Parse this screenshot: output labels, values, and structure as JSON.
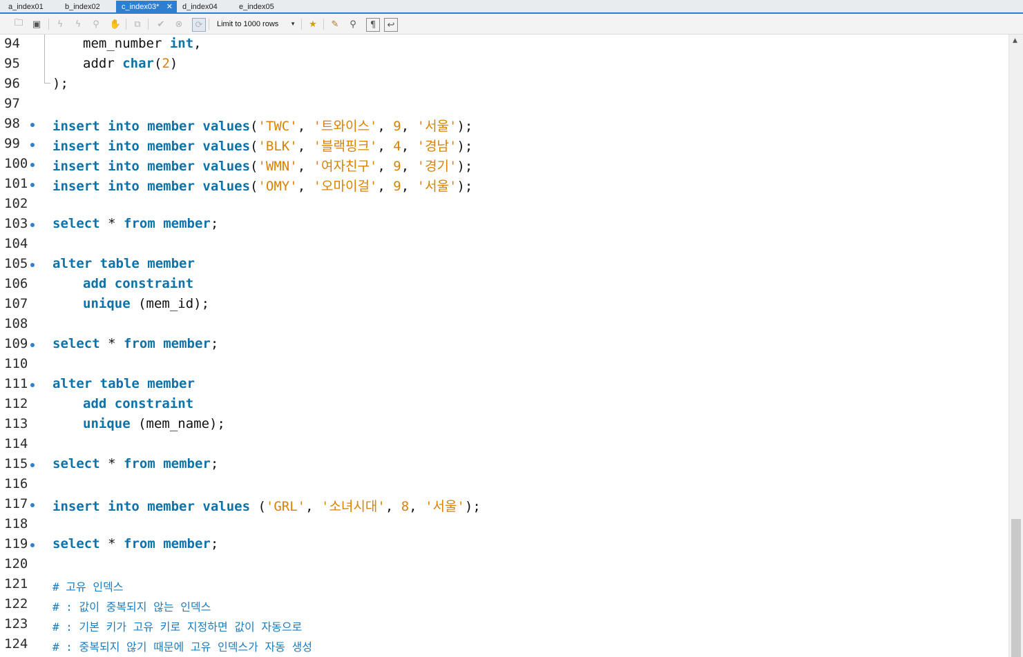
{
  "tabs": [
    {
      "label": "a_index01"
    },
    {
      "label": "b_index02"
    },
    {
      "label": "c_index03*"
    },
    {
      "label": "d_index04"
    },
    {
      "label": "e_index05"
    }
  ],
  "toolbar": {
    "limit_label": "Limit to 1000 rows"
  },
  "lines": [
    {
      "num": "94"
    },
    {
      "num": "95"
    },
    {
      "num": "96"
    },
    {
      "num": "97"
    },
    {
      "num": "98"
    },
    {
      "num": "99"
    },
    {
      "num": "100"
    },
    {
      "num": "101"
    },
    {
      "num": "102"
    },
    {
      "num": "103"
    },
    {
      "num": "104"
    },
    {
      "num": "105"
    },
    {
      "num": "106"
    },
    {
      "num": "107"
    },
    {
      "num": "108"
    },
    {
      "num": "109"
    },
    {
      "num": "110"
    },
    {
      "num": "111"
    },
    {
      "num": "112"
    },
    {
      "num": "113"
    },
    {
      "num": "114"
    },
    {
      "num": "115"
    },
    {
      "num": "116"
    },
    {
      "num": "117"
    },
    {
      "num": "118"
    },
    {
      "num": "119"
    },
    {
      "num": "120"
    },
    {
      "num": "121"
    },
    {
      "num": "122"
    },
    {
      "num": "123"
    },
    {
      "num": "124"
    }
  ],
  "code": {
    "l94": {
      "ident": "mem_number",
      "type": "int",
      "comma": ","
    },
    "l95": {
      "ident": "addr",
      "type": "char",
      "p1": "(",
      "n": "2",
      "p2": ")"
    },
    "l96": {
      "text": ");"
    },
    "l98": {
      "kw1": "insert into",
      "tbl": "member",
      "kw2": "values",
      "a": "'TWC'",
      "b": "'트와이스'",
      "c": "9",
      "d": "'서울'"
    },
    "l99": {
      "kw1": "insert into",
      "tbl": "member",
      "kw2": "values",
      "a": "'BLK'",
      "b": "'블랙핑크'",
      "c": "4",
      "d": "'경남'"
    },
    "l100": {
      "kw1": "insert into",
      "tbl": "member",
      "kw2": "values",
      "a": "'WMN'",
      "b": "'여자친구'",
      "c": "9",
      "d": "'경기'"
    },
    "l101": {
      "kw1": "insert into",
      "tbl": "member",
      "kw2": "values",
      "a": "'OMY'",
      "b": "'오마이걸'",
      "c": "9",
      "d": "'서울'"
    },
    "l103": {
      "kw1": "select",
      "star": "*",
      "kw2": "from",
      "tbl": "member"
    },
    "l105": {
      "kw1": "alter table",
      "tbl": "member"
    },
    "l106": {
      "kw1": "add constraint"
    },
    "l107": {
      "kw1": "unique",
      "rest": "(mem_id);"
    },
    "l109": {
      "kw1": "select",
      "star": "*",
      "kw2": "from",
      "tbl": "member"
    },
    "l111": {
      "kw1": "alter table",
      "tbl": "member"
    },
    "l112": {
      "kw1": "add constraint"
    },
    "l113": {
      "kw1": "unique",
      "rest": "(mem_name);"
    },
    "l115": {
      "kw1": "select",
      "star": "*",
      "kw2": "from",
      "tbl": "member"
    },
    "l117": {
      "kw1": "insert into",
      "tbl": "member",
      "kw2": "values",
      "a": "'GRL'",
      "b": "'소녀시대'",
      "c": "8",
      "d": "'서울'"
    },
    "l119": {
      "kw1": "select",
      "star": "*",
      "kw2": "from",
      "tbl": "member"
    },
    "l121": {
      "text": "# 고유 인덱스"
    },
    "l122": {
      "text": "# : 값이 중복되지 않는 인덱스"
    },
    "l123": {
      "text": "# : 기본 키가 고유 키로 지정하면 값이 자동으로"
    },
    "l124": {
      "text": "# : 중복되지 않기 때문에 고유 인덱스가 자동 생성"
    }
  },
  "colors": {
    "accent": "#2f7fd0",
    "keyword": "#0d72a8",
    "string": "#d98200"
  },
  "icons": [
    "open-folder-icon",
    "save-icon",
    "execute-icon",
    "execute-line-icon",
    "explain-icon",
    "stop-icon",
    "toggle-continue-icon",
    "commit-icon",
    "rollback-icon",
    "autocommit-icon",
    "add-snippet-icon",
    "beautify-icon",
    "find-icon",
    "invisible-chars-icon",
    "wrap-icon"
  ]
}
